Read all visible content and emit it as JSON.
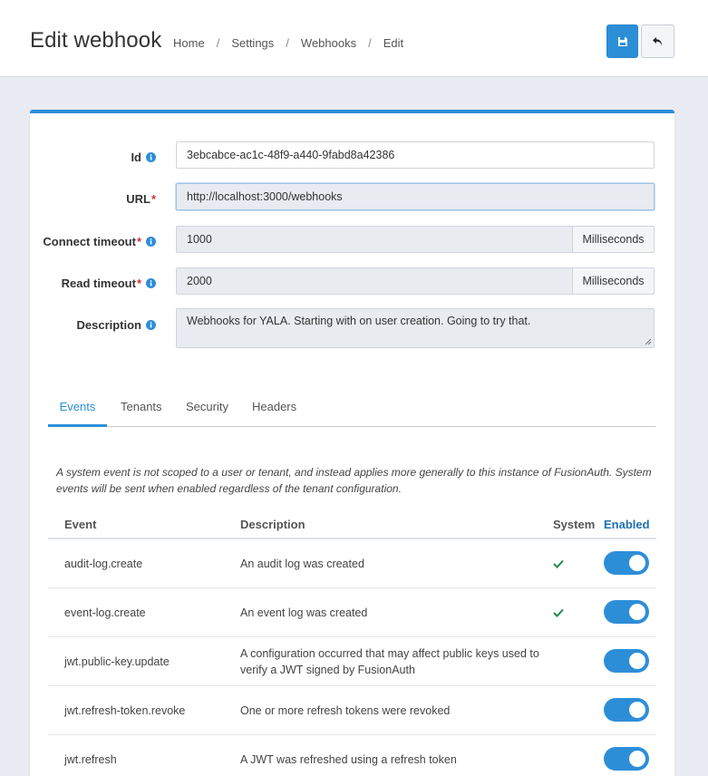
{
  "header": {
    "title": "Edit webhook",
    "breadcrumb": [
      "Home",
      "Settings",
      "Webhooks",
      "Edit"
    ],
    "save_icon": "save-icon",
    "back_icon": "undo-icon"
  },
  "form": {
    "id_label": "Id",
    "id_value": "3ebcabce-ac1c-48f9-a440-9fabd8a42386",
    "url_label": "URL",
    "url_value": "http://localhost:3000/webhooks",
    "connect_timeout_label": "Connect timeout",
    "connect_timeout_value": "1000",
    "connect_timeout_unit": "Milliseconds",
    "read_timeout_label": "Read timeout",
    "read_timeout_value": "2000",
    "read_timeout_unit": "Milliseconds",
    "description_label": "Description",
    "description_value": "Webhooks for YALA.  Starting with on user creation.  Going to try that.",
    "required_marker": "*"
  },
  "tabs": [
    {
      "label": "Events",
      "active": true
    },
    {
      "label": "Tenants",
      "active": false
    },
    {
      "label": "Security",
      "active": false
    },
    {
      "label": "Headers",
      "active": false
    }
  ],
  "events": {
    "note": "A system event is not scoped to a user or tenant, and instead applies more generally to this instance of FusionAuth. System events will be sent when enabled regardless of the tenant configuration.",
    "columns": {
      "event": "Event",
      "description": "Description",
      "system": "System",
      "enabled": "Enabled"
    },
    "rows": [
      {
        "event": "audit-log.create",
        "description": "An audit log was created",
        "system": true,
        "enabled": true
      },
      {
        "event": "event-log.create",
        "description": "An event log was created",
        "system": true,
        "enabled": true
      },
      {
        "event": "jwt.public-key.update",
        "description": "A configuration occurred that may affect public keys used to verify a JWT signed by FusionAuth",
        "system": false,
        "enabled": true
      },
      {
        "event": "jwt.refresh-token.revoke",
        "description": "One or more refresh tokens were revoked",
        "system": false,
        "enabled": true
      },
      {
        "event": "jwt.refresh",
        "description": "A JWT was refreshed using a refresh token",
        "system": false,
        "enabled": true
      }
    ]
  },
  "colors": {
    "accent": "#2d8ed8",
    "check": "#1f8a4c",
    "required": "#cc3333"
  }
}
